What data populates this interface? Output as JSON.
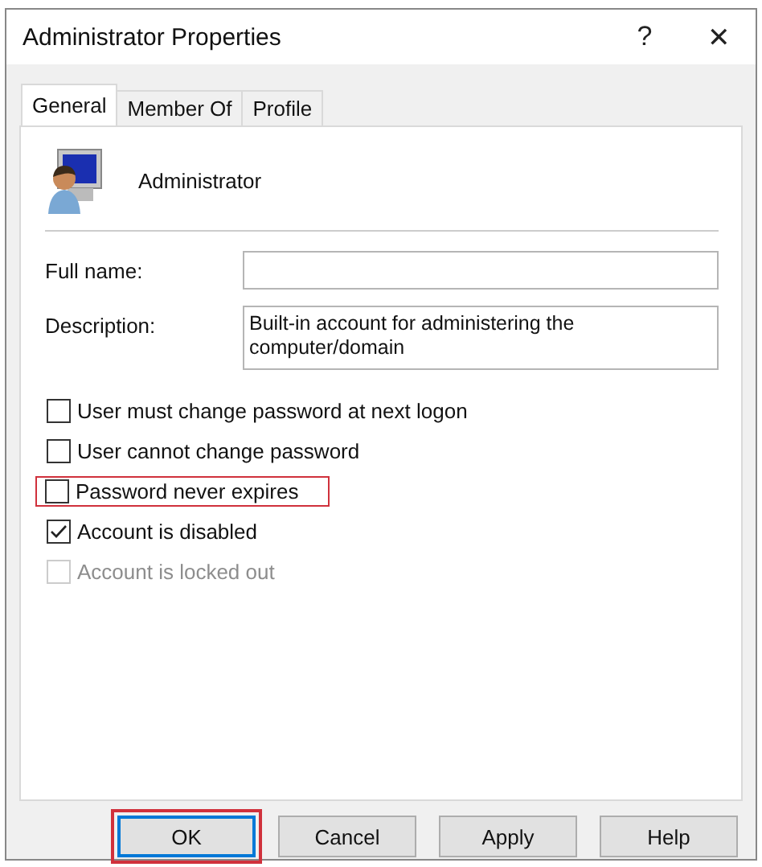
{
  "window": {
    "title": "Administrator Properties",
    "help": "?",
    "close": "✕"
  },
  "tabs": [
    {
      "label": "General",
      "selected": true
    },
    {
      "label": "Member Of",
      "selected": false
    },
    {
      "label": "Profile",
      "selected": false
    }
  ],
  "user": {
    "name": "Administrator"
  },
  "fields": [
    {
      "label": "Full name:",
      "multiline": false
    },
    {
      "label": "Description:",
      "value": "Built-in account for administering the computer/domain",
      "multiline": true
    }
  ],
  "options": [
    {
      "label": "User must change password at next logon",
      "checked": false,
      "disabled": false,
      "highlighted": false
    },
    {
      "label": "User cannot change password",
      "checked": false,
      "disabled": false,
      "highlighted": false
    },
    {
      "label": "Password never expires",
      "checked": false,
      "disabled": false,
      "highlighted": true
    },
    {
      "label": "Account is disabled",
      "checked": true,
      "disabled": false,
      "highlighted": false
    },
    {
      "label": "Account is locked out",
      "checked": false,
      "disabled": true,
      "highlighted": false
    }
  ],
  "buttons": [
    {
      "label": "OK",
      "default": true,
      "highlighted": true
    },
    {
      "label": "Cancel",
      "default": false,
      "highlighted": false
    },
    {
      "label": "Apply",
      "default": false,
      "highlighted": false
    },
    {
      "label": "Help",
      "default": false,
      "highlighted": false
    }
  ]
}
